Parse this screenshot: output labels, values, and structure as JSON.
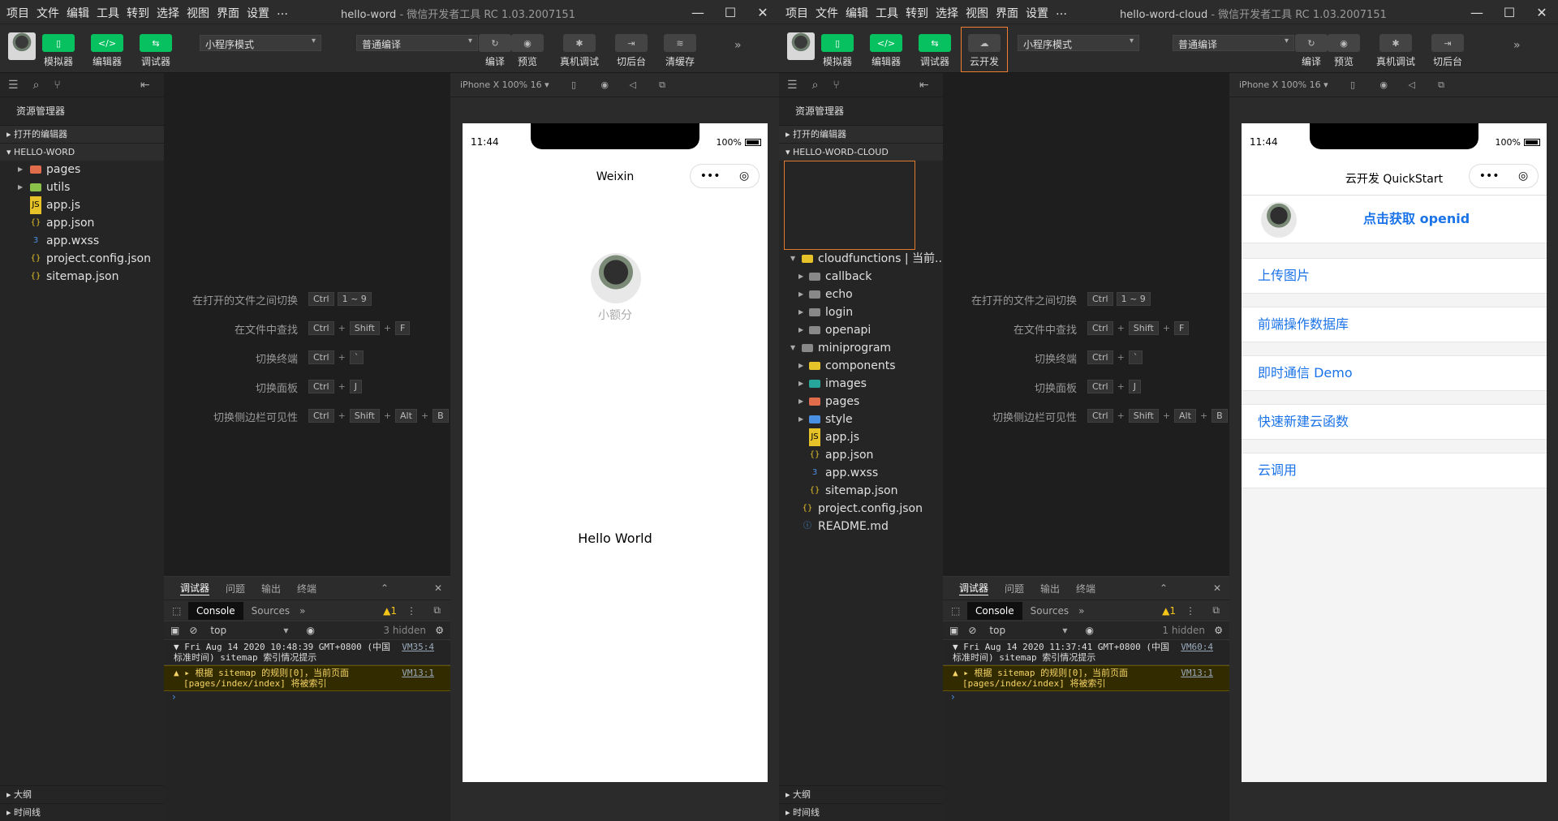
{
  "menu": [
    "项目",
    "文件",
    "编辑",
    "工具",
    "转到",
    "选择",
    "视图",
    "界面",
    "设置",
    "…"
  ],
  "w1": {
    "title": "hello-word",
    "subtitle": "- 微信开发者工具 RC 1.03.2007151",
    "toolbar": {
      "simulator": "模拟器",
      "editor": "编辑器",
      "debugger": "调试器",
      "mode": "小程序模式",
      "compile_mode": "普通编译",
      "compile": "编译",
      "preview": "预览",
      "remote": "真机调试",
      "background": "切后台",
      "clear": "清缓存"
    },
    "explorer": "资源管理器",
    "open_editors": "打开的编辑器",
    "project": "HELLO-WORD",
    "files": [
      "pages",
      "utils",
      "app.js",
      "app.json",
      "app.wxss",
      "project.config.json",
      "sitemap.json"
    ],
    "outline": "大纲",
    "timeline": "时间线",
    "device": "iPhone X 100% 16 ▾",
    "phone": {
      "time": "11:44",
      "battery": "100%",
      "title": "Weixin",
      "nickname": "小额分",
      "hello": "Hello World"
    },
    "console": {
      "time_line": "▼ Fri Aug 14 2020 10:48:39 GMT+0800 (中国",
      "time_line2": "标准时间) sitemap 索引情况提示",
      "time_link": "VM35:4",
      "warn_line": "▲ ▸ 根据 sitemap 的规则[0]，当前页面",
      "warn_line2": "[pages/index/index] 将被索引",
      "warn_link": "VM13:1",
      "hidden": "3 hidden"
    }
  },
  "w2": {
    "title": "hello-word-cloud",
    "subtitle": "- 微信开发者工具 RC 1.03.2007151",
    "toolbar": {
      "simulator": "模拟器",
      "editor": "编辑器",
      "debugger": "调试器",
      "cloud": "云开发",
      "mode": "小程序模式",
      "compile_mode": "普通编译",
      "compile": "编译",
      "preview": "预览",
      "remote": "真机调试",
      "background": "切后台"
    },
    "explorer": "资源管理器",
    "open_editors": "打开的编辑器",
    "project": "HELLO-WORD-CLOUD",
    "cloudfunctions": "cloudfunctions | 当前...",
    "cloud_items": [
      "callback",
      "echo",
      "login",
      "openapi"
    ],
    "miniprogram": "miniprogram",
    "mini_items": [
      "components",
      "images",
      "pages",
      "style",
      "app.js",
      "app.json",
      "app.wxss",
      "sitemap.json"
    ],
    "root_items": [
      "project.config.json",
      "README.md"
    ],
    "outline": "大纲",
    "timeline": "时间线",
    "device": "iPhone X 100% 16 ▾",
    "phone": {
      "time": "11:44",
      "battery": "100%",
      "title": "云开发 QuickStart",
      "openid": "点击获取 openid",
      "items": [
        "上传图片",
        "前端操作数据库",
        "即时通信 Demo",
        "快速新建云函数",
        "云调用"
      ]
    },
    "console": {
      "time_line": "▼ Fri Aug 14 2020 11:37:41 GMT+0800 (中国",
      "time_line2": "标准时间) sitemap 索引情况提示",
      "time_link": "VM60:4",
      "warn_line": "▲ ▸ 根据 sitemap 的规则[0]，当前页面",
      "warn_line2": "[pages/index/index] 将被索引",
      "warn_link": "VM13:1",
      "hidden": "1 hidden"
    }
  },
  "shortcuts": [
    {
      "label": "在打开的文件之间切换",
      "keys": [
        "Ctrl",
        "1 ~ 9"
      ]
    },
    {
      "label": "在文件中查找",
      "keys": [
        "Ctrl",
        "Shift",
        "F"
      ]
    },
    {
      "label": "切换终端",
      "keys": [
        "Ctrl",
        "`"
      ]
    },
    {
      "label": "切换面板",
      "keys": [
        "Ctrl",
        "J"
      ]
    },
    {
      "label": "切换侧边栏可见性",
      "keys": [
        "Ctrl",
        "Shift",
        "Alt",
        "B"
      ]
    }
  ],
  "debug_tabs": [
    "调试器",
    "问题",
    "输出",
    "终端"
  ],
  "console_tabs": {
    "console": "Console",
    "sources": "Sources",
    "more": "»",
    "warn_count": "1"
  },
  "console_filter": "top",
  "prompt": "›",
  "colors": {
    "green": "#07c160",
    "accent": "#f08030",
    "link": "#1a73e8"
  }
}
